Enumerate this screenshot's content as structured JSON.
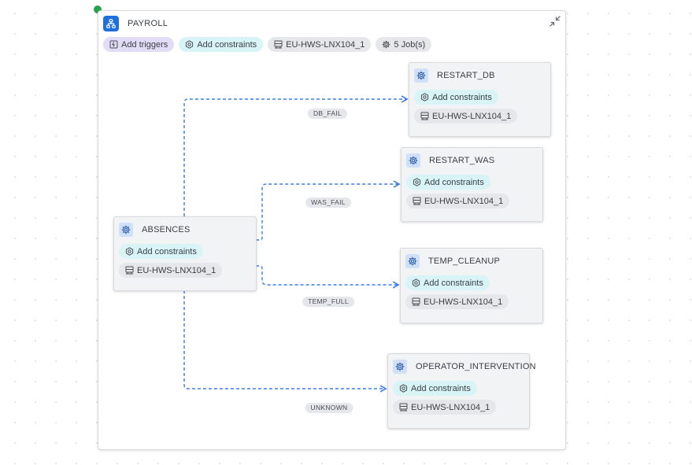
{
  "workflow": {
    "title": "PAYROLL",
    "add_triggers_label": "Add triggers",
    "add_constraints_label": "Add constraints",
    "server_label": "EU-HWS-LNX104_1",
    "jobs_count_label": "5 Job(s)",
    "status_color": "#22a447",
    "accent_color": "#1e6fe0"
  },
  "jobs": [
    {
      "name": "ABSENCES",
      "constraints_label": "Add constraints",
      "server_label": "EU-HWS-LNX104_1"
    },
    {
      "name": "RESTART_DB",
      "constraints_label": "Add constraints",
      "server_label": "EU-HWS-LNX104_1"
    },
    {
      "name": "RESTART_WAS",
      "constraints_label": "Add constraints",
      "server_label": "EU-HWS-LNX104_1"
    },
    {
      "name": "TEMP_CLEANUP",
      "constraints_label": "Add constraints",
      "server_label": "EU-HWS-LNX104_1"
    },
    {
      "name": "OPERATOR_INTERVENTION",
      "constraints_label": "Add constraints",
      "server_label": "EU-HWS-LNX104_1"
    }
  ],
  "edges": [
    {
      "from": "ABSENCES",
      "to": "RESTART_DB",
      "label": "DB_FAIL"
    },
    {
      "from": "ABSENCES",
      "to": "RESTART_WAS",
      "label": "WAS_FAIL"
    },
    {
      "from": "ABSENCES",
      "to": "TEMP_CLEANUP",
      "label": "TEMP_FULL"
    },
    {
      "from": "ABSENCES",
      "to": "OPERATOR_INTERVENTION",
      "label": "UNKNOWN"
    }
  ],
  "icons": {
    "workflow": "workflow-tree-icon",
    "job": "gear-icon",
    "constraint": "constraint-icon",
    "server": "server-icon",
    "trigger": "trigger-icon",
    "collapse": "collapse-icon"
  }
}
